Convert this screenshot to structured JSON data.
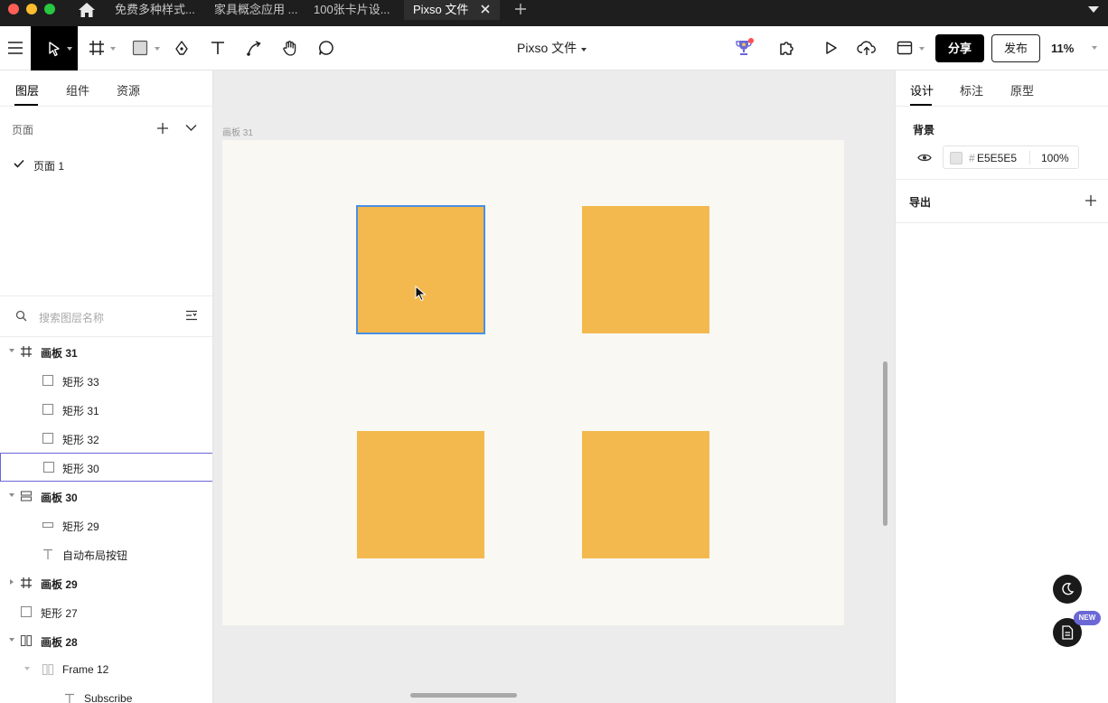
{
  "browser_tabs": [
    {
      "label": "免费多种样式..."
    },
    {
      "label": "家具概念应用 ..."
    },
    {
      "label": "100张卡片设..."
    },
    {
      "label": "Pixso 文件",
      "active": true
    }
  ],
  "toolbar": {
    "file_title": "Pixso 文件",
    "share_label": "分享",
    "publish_label": "发布",
    "zoom": "11%"
  },
  "left_panel": {
    "tabs": [
      "图层",
      "组件",
      "资源"
    ],
    "pages_label": "页面",
    "pages": [
      "页面 1"
    ],
    "search_placeholder": "搜索图层名称",
    "layers": [
      {
        "name": "画板 31",
        "bold": true
      },
      {
        "name": "矩形 33"
      },
      {
        "name": "矩形 31"
      },
      {
        "name": "矩形 32"
      },
      {
        "name": "矩形 30",
        "selected": true
      },
      {
        "name": "画板 30",
        "bold": true
      },
      {
        "name": "矩形 29"
      },
      {
        "name": "自动布局按钮"
      },
      {
        "name": "画板 29",
        "bold": true
      },
      {
        "name": "矩形 27"
      },
      {
        "name": "画板 28",
        "bold": true
      },
      {
        "name": "Frame 12"
      },
      {
        "name": "Subscribe"
      }
    ]
  },
  "canvas": {
    "frame_label": "画板 31",
    "artboard_color": "#faf8f3",
    "rect_color": "#f3b94f",
    "selection_color": "#4a90e2"
  },
  "right_panel": {
    "tabs": [
      "设计",
      "标注",
      "原型"
    ],
    "background_title": "背景",
    "hash": "#",
    "bg_hex": "E5E5E5",
    "bg_opacity": "100",
    "percent": "%",
    "export_title": "导出"
  },
  "fab": {
    "new_badge": "NEW"
  }
}
